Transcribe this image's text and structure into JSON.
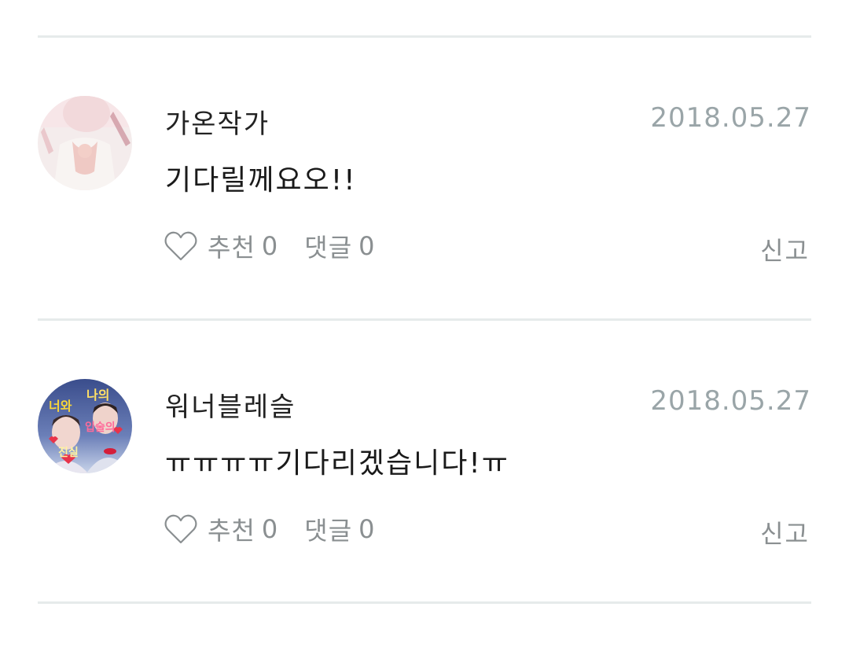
{
  "comments": [
    {
      "author": "가온작가",
      "date": "2018.05.27",
      "text": "기다릴께요오!!",
      "like_label": "추천",
      "like_count": "0",
      "reply_label": "댓글",
      "reply_count": "0",
      "report_label": "신고"
    },
    {
      "author": "워너블레슬",
      "date": "2018.05.27",
      "text": "ㅠㅠㅠㅠ기다리겠습니다!ㅠ",
      "like_label": "추천",
      "like_count": "0",
      "reply_label": "댓글",
      "reply_count": "0",
      "report_label": "신고",
      "avatar_text": [
        "너와",
        "나의",
        "입술의",
        "진실"
      ]
    }
  ],
  "colors": {
    "divider": "#e6ebeb",
    "date": "#9aa5a8",
    "action": "#8a8f91"
  }
}
